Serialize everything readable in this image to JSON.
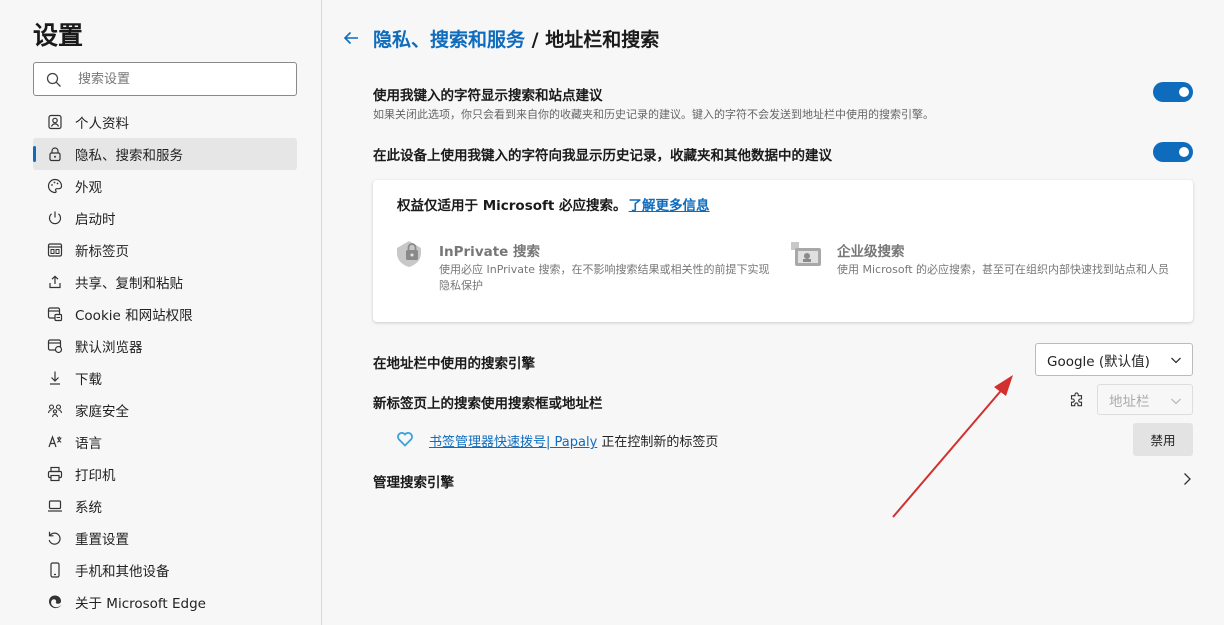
{
  "sidebar": {
    "title": "设置",
    "search_placeholder": "搜索设置",
    "items": [
      {
        "label": "个人资料"
      },
      {
        "label": "隐私、搜索和服务"
      },
      {
        "label": "外观"
      },
      {
        "label": "启动时"
      },
      {
        "label": "新标签页"
      },
      {
        "label": "共享、复制和粘贴"
      },
      {
        "label": "Cookie 和网站权限"
      },
      {
        "label": "默认浏览器"
      },
      {
        "label": "下载"
      },
      {
        "label": "家庭安全"
      },
      {
        "label": "语言"
      },
      {
        "label": "打印机"
      },
      {
        "label": "系统"
      },
      {
        "label": "重置设置"
      },
      {
        "label": "手机和其他设备"
      },
      {
        "label": "关于 Microsoft Edge"
      }
    ]
  },
  "header": {
    "breadcrumb_parent": "隐私、搜索和服务",
    "breadcrumb_separator": " / ",
    "breadcrumb_current": "地址栏和搜索"
  },
  "settings": {
    "suggest_title": "使用我键入的字符显示搜索和站点建议",
    "suggest_desc": "如果关闭此选项，你只会看到来自你的收藏夹和历史记录的建议。键入的字符不会发送到地址栏中使用的搜索引擎。",
    "history_title": "在此设备上使用我键入的字符向我显示历史记录，收藏夹和其他数据中的建议",
    "suggest_on": true,
    "history_on": true
  },
  "card": {
    "head": "权益仅适用于 Microsoft 必应搜索。",
    "learn_more": "了解更多信息",
    "inprivate_title": "InPrivate 搜索",
    "inprivate_desc": "使用必应 InPrivate 搜索，在不影响搜索结果或相关性的前提下实现隐私保护",
    "enterprise_title": "企业级搜索",
    "enterprise_desc": "使用 Microsoft 的必应搜索，甚至可在组织内部快速找到站点和人员"
  },
  "engine": {
    "label": "在地址栏中使用的搜索引擎",
    "value": "Google (默认值)"
  },
  "newtab": {
    "label": "新标签页上的搜索使用搜索框或地址栏",
    "value": "地址栏",
    "ext_link": "书签管理器快速拨号| Papaly",
    "ext_suffix": " 正在控制新的标签页",
    "disable_label": "禁用"
  },
  "manage": {
    "label": "管理搜索引擎"
  },
  "colors": {
    "accent": "#0f6cbd",
    "arrow": "#d32f2f"
  }
}
